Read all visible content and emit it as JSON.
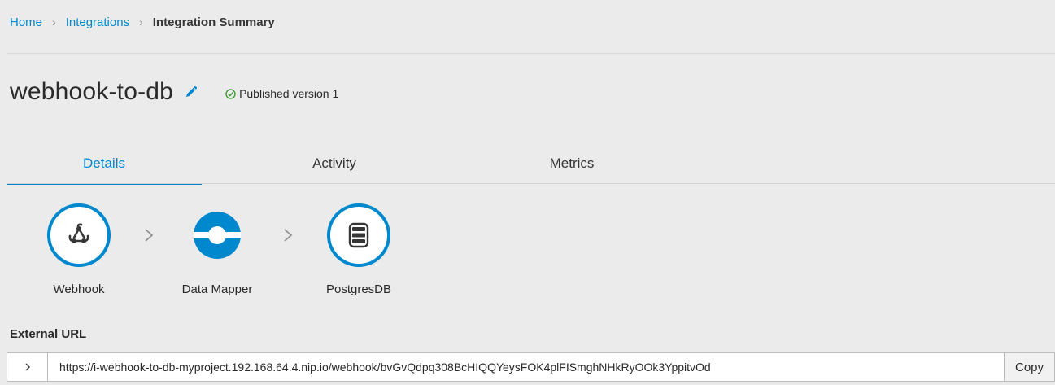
{
  "breadcrumb": {
    "items": [
      {
        "label": "Home"
      },
      {
        "label": "Integrations"
      },
      {
        "label": "Integration Summary"
      }
    ]
  },
  "integration": {
    "title": "webhook-to-db",
    "status": "Published version 1",
    "status_color": "#3f9c35",
    "edit_icon": "pencil-icon"
  },
  "tabs": [
    {
      "label": "Details",
      "active": true
    },
    {
      "label": "Activity",
      "active": false
    },
    {
      "label": "Metrics",
      "active": false
    }
  ],
  "flow": {
    "steps": [
      {
        "label": "Webhook",
        "icon": "webhook-icon"
      },
      {
        "label": "Data Mapper",
        "icon": "data-mapper-icon"
      },
      {
        "label": "PostgresDB",
        "icon": "database-icon"
      }
    ]
  },
  "external_url": {
    "label": "External URL",
    "value": "https://i-webhook-to-db-myproject.192.168.64.4.nip.io/webhook/bvGvQdpq308BcHIQQYeysFOK4plFISmghNHkRyOOk3YppitvOd",
    "copy_label": "Copy"
  },
  "colors": {
    "accent": "#0088ce",
    "background": "#ebebeb"
  }
}
